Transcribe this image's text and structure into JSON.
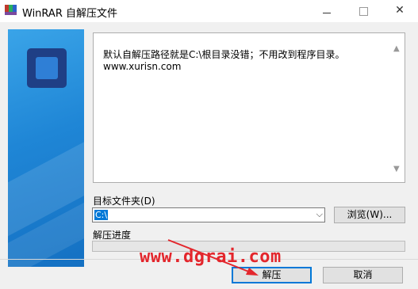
{
  "window": {
    "title": "WinRAR 自解压文件",
    "controls": {
      "minimize": "—",
      "maximize": "",
      "close": "✕"
    }
  },
  "message": {
    "line1": "默认自解压路径就是C:\\根目录没错；不用改到程序目录。",
    "line2": "www.xurisn.com"
  },
  "destination": {
    "label": "目标文件夹(D)",
    "value": "C:\\",
    "browse_label": "浏览(W)..."
  },
  "progress": {
    "label": "解压进度",
    "fraction": 0
  },
  "buttons": {
    "extract": "解压",
    "cancel": "取消"
  },
  "watermark": "www.dgrai.com",
  "colors": {
    "accent": "#0078d7",
    "banner": "#1f86d6",
    "watermark": "#e3262c"
  }
}
